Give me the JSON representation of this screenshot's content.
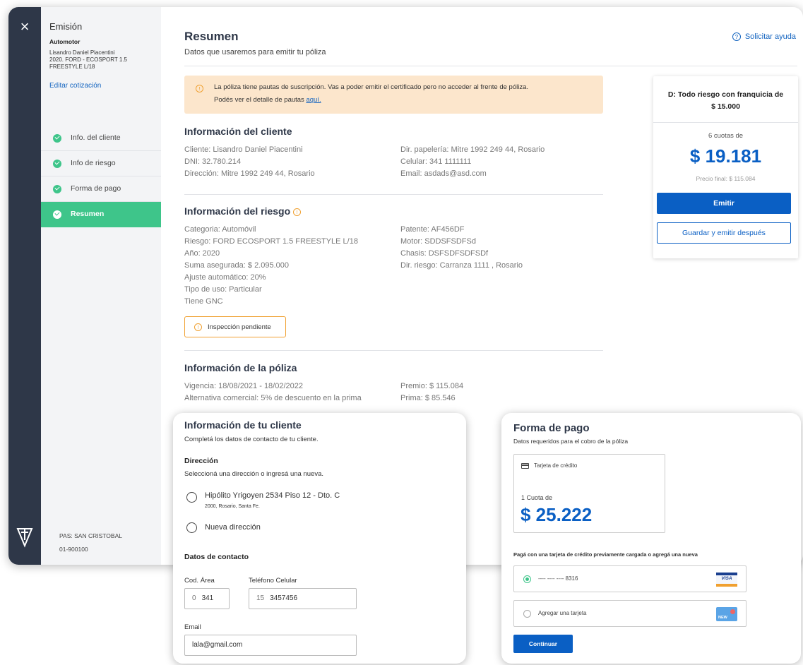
{
  "sidebar": {
    "close_icon": "×",
    "title": "Emisión",
    "subtitle": "Automotor",
    "client_name": "Lisandro Daniel Piacentini",
    "vehicle": "2020. FORD - ECOSPORT 1.5 FREESTYLE L/18",
    "edit_link": "Editar cotización",
    "steps": [
      {
        "label": "Info. del cliente",
        "done": true
      },
      {
        "label": "Info de riesgo",
        "done": true
      },
      {
        "label": "Forma de pago",
        "done": true
      },
      {
        "label": "Resumen",
        "active": true
      }
    ],
    "pas": "PAS: SAN CRISTOBAL",
    "code": "01-900100"
  },
  "header": {
    "title": "Resumen",
    "subtitle": "Datos que usaremos para emitir tu póliza",
    "help": "Solicitar ayuda"
  },
  "alert": {
    "line1": "La póliza tiene pautas de suscripción. Vas a poder emitir el certificado pero no acceder al frente de póliza.",
    "line2_prefix": "Podés ver el detalle de pautas",
    "link": "aquí."
  },
  "client_info": {
    "title": "Información del cliente",
    "left": [
      "Cliente: Lisandro Daniel Piacentini",
      "DNI: 32.780.214",
      "Dirección: Mitre 1992 249 44, Rosario"
    ],
    "right": [
      "Dir. papelería: Mitre 1992 249 44, Rosario",
      "Celular: 341 1111111",
      "Email: asdads@asd.com"
    ]
  },
  "risk_info": {
    "title": "Información del riesgo",
    "left": [
      "Categoria: Automóvil",
      "Riesgo: FORD ECOSPORT 1.5 FREESTYLE L/18",
      "Año: 2020",
      "Suma asegurada: $ 2.095.000",
      "Ajuste automático: 20%",
      "Tipo de uso: Particular",
      "Tiene GNC"
    ],
    "right": [
      "Patente: AF456DF",
      "Motor: SDDSFSDFSd",
      "Chasis: DSFSDFSDFSDf",
      "Dir. riesgo: Carranza 1111 , Rosario"
    ],
    "inspection": "Inspección pendiente"
  },
  "policy_info": {
    "title": "Información de la póliza",
    "left": [
      "Vigencia: 18/08/2021 - 18/02/2022",
      "Alternativa comercial: 5% de descuento en la prima"
    ],
    "right": [
      "Premio: $ 115.084",
      "Prima: $ 85.546"
    ]
  },
  "summary": {
    "plan_line1": "D: Todo riesgo con franquicia de",
    "plan_line2": "$ 15.000",
    "installments": "6 cuotas de",
    "amount": "$ 19.181",
    "final_price": "Precio final: $ 115.084",
    "emit_label": "Emitir",
    "save_label": "Guardar y emitir después"
  },
  "client_card": {
    "title": "Información de tu cliente",
    "subtitle": "Completá los datos de contacto de tu cliente.",
    "address_title": "Dirección",
    "address_subtitle": "Seleccioná una dirección o ingresá una nueva.",
    "address_option": "Hipólito Yrigoyen 2534 Piso 12 - Dto. C",
    "address_detail": "2000, Rosario, Santa Fe.",
    "new_address": "Nueva dirección",
    "contact_title": "Datos de contacto",
    "area_label": "Cod. Área",
    "area_prefix": "0",
    "area_value": "341",
    "phone_label": "Teléfono Celular",
    "phone_prefix": "15",
    "phone_value": "3457456",
    "email_label": "Email",
    "email_value": "lala@gmail.com"
  },
  "payment_card": {
    "title": "Forma de pago",
    "subtitle": "Datos requeridos para el cobro de la póliza",
    "card_type": "Tarjeta de crédito",
    "installment": "1 Cuota de",
    "amount": "$ 25.222",
    "info": "Pagá con una tarjeta de crédito previamente cargada o agregá una nueva",
    "saved_card": "---- ---- ---- 8316",
    "visa_label": "VISA",
    "add_card": "Agregar una tarjeta",
    "new_card_label": "NEW",
    "continue_label": "Continuar"
  },
  "colors": {
    "primary": "#0a5fc4",
    "success": "#3ec58a",
    "rail": "#2e3748",
    "warning_bg": "#fce6cc",
    "warning": "#f0a030"
  }
}
